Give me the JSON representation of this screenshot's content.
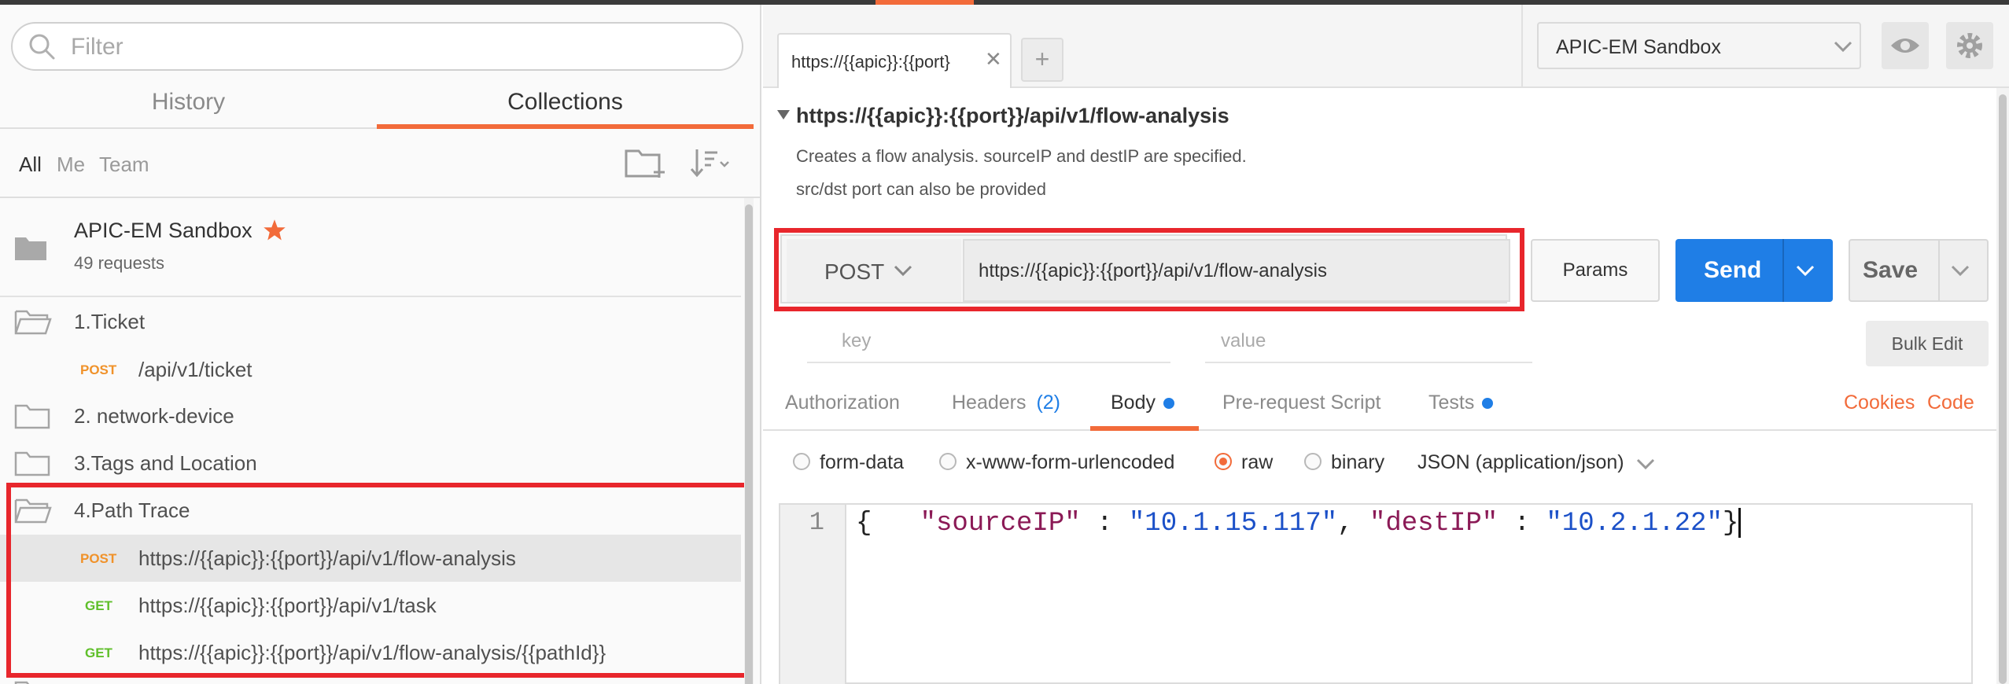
{
  "sidebar": {
    "filter_placeholder": "Filter",
    "tabs": [
      "History",
      "Collections"
    ],
    "filters": [
      "All",
      "Me",
      "Team"
    ],
    "collection": {
      "name": "APIC-EM Sandbox",
      "count": "49 requests"
    },
    "folders": {
      "ticket": "1.Ticket",
      "network": "2. network-device",
      "tags": "3.Tags and Location",
      "path": "4.Path Trace"
    },
    "requests": [
      {
        "method": "POST",
        "url": "/api/v1/ticket"
      },
      {
        "method": "POST",
        "url": "https://{{apic}}:{{port}}/api/v1/flow-analysis"
      },
      {
        "method": "GET",
        "url": "https://{{apic}}:{{port}}/api/v1/task"
      },
      {
        "method": "GET",
        "url": "https://{{apic}}:{{port}}/api/v1/flow-analysis/{{pathId}}"
      }
    ]
  },
  "tab": {
    "title": "https://{{apic}}:{{port}"
  },
  "environment": "APIC-EM Sandbox",
  "request": {
    "title": "https://{{apic}}:{{port}}/api/v1/flow-analysis",
    "desc1": "Creates a flow analysis. sourceIP and destIP are specified.",
    "desc2": "src/dst port can also be provided",
    "method": "POST",
    "url": "https://{{apic}}:{{port}}/api/v1/flow-analysis"
  },
  "buttons": {
    "params": "Params",
    "send": "Send",
    "save": "Save",
    "bulk_edit": "Bulk Edit"
  },
  "kv": {
    "key": "key",
    "value": "value"
  },
  "subtabs": {
    "authorization": "Authorization",
    "headers": "Headers",
    "headers_count": "(2)",
    "body": "Body",
    "prerequest": "Pre-request Script",
    "tests": "Tests",
    "cookies": "Cookies",
    "code": "Code"
  },
  "body_modes": {
    "formdata": "form-data",
    "urlencoded": "x-www-form-urlencoded",
    "raw": "raw",
    "binary": "binary",
    "content_type": "JSON (application/json)"
  },
  "editor": {
    "line": "1",
    "open": "{",
    "k1": "\"sourceIP\"",
    "sep": " : ",
    "v1": "\"10.1.15.117\"",
    "comma": ", ",
    "k2": "\"destIP\"",
    "v2": "\"10.2.1.22\"",
    "close": "}"
  },
  "colors": {
    "accent": "#f26b3a",
    "primary": "#1f7ee6",
    "highlight": "#e8262c"
  }
}
